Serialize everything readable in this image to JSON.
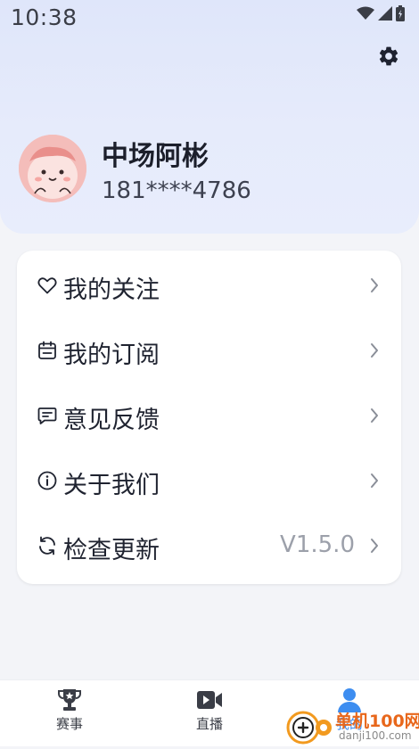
{
  "status_bar": {
    "time": "10:38"
  },
  "profile": {
    "name": "中场阿彬",
    "phone": "181****4786"
  },
  "menu": [
    {
      "label": "我的关注",
      "icon": "heart-icon"
    },
    {
      "label": "我的订阅",
      "icon": "calendar-icon"
    },
    {
      "label": "意见反馈",
      "icon": "message-icon"
    },
    {
      "label": "关于我们",
      "icon": "info-icon"
    },
    {
      "label": "检查更新",
      "icon": "refresh-icon",
      "value": "V1.5.0"
    }
  ],
  "tabs": [
    {
      "label": "赛事",
      "icon": "trophy-icon"
    },
    {
      "label": "直播",
      "icon": "video-icon"
    },
    {
      "label": "我的",
      "icon": "user-icon",
      "active": true
    }
  ],
  "watermark": {
    "text": "单机100网",
    "url": "danji100.com"
  },
  "colors": {
    "accent": "#3d8df0",
    "header_bg": "#e3e9fb",
    "page_bg": "#f3f4f8"
  }
}
